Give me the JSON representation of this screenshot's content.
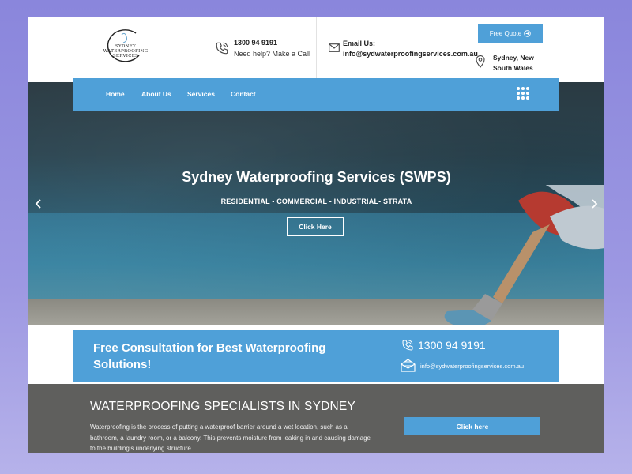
{
  "brand": {
    "logo_text": [
      "SYDNEY",
      "WATERPROOFING",
      "SERVICES"
    ]
  },
  "header": {
    "phone_number": "1300 94 9191",
    "phone_caption": "Need help? Make a Call",
    "email_label": "Email Us:",
    "email_value": "info@sydwaterproofingservices.com.au",
    "quote_button_label": "Free Quote",
    "location": "Sydney, New South Wales"
  },
  "nav": {
    "items": [
      {
        "label": "Home"
      },
      {
        "label": "About Us"
      },
      {
        "label": "Services"
      },
      {
        "label": "Contact"
      }
    ]
  },
  "hero": {
    "title": "Sydney Waterproofing Services (SWPS)",
    "subtitle": "RESIDENTIAL - COMMERCIAL - INDUSTRIAL- STRATA",
    "cta_label": "Click Here"
  },
  "consultation": {
    "title": "Free Consultation for Best Waterproofing Solutions!",
    "phone_number": "1300 94 9191",
    "email": "info@sydwaterproofingservices.com.au"
  },
  "specialists": {
    "title": "WATERPROOFING SPECIALISTS IN SYDNEY",
    "body": "Waterproofing is the process of putting a waterproof barrier around a wet location, such as a bathroom, a laundry room, or a balcony. This prevents moisture from leaking in and causing damage to the building's underlying structure.",
    "button_label": "Click here"
  },
  "colors": {
    "accent": "#4fa0d8",
    "section_dark": "#5f5f5d",
    "backdrop": "#8a86dc"
  },
  "icons": {
    "header_phone": "phone-icon",
    "header_mail": "mail-icon",
    "quote_arrow": "arrow-circle-right-icon",
    "location": "map-pin-icon",
    "menu": "grid-dots-icon",
    "slider_prev": "chevron-left-icon",
    "slider_next": "chevron-right-icon",
    "consult_phone": "phone-icon",
    "consult_mail": "mail-open-icon"
  }
}
